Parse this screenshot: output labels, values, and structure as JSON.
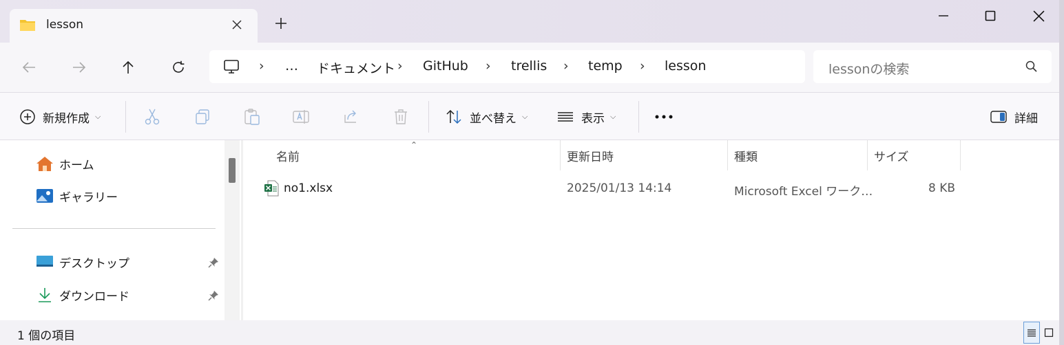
{
  "window": {
    "tab_title": "lesson",
    "minimize_icon": "minimize-icon",
    "maximize_icon": "maximize-icon",
    "close_icon": "close-icon"
  },
  "breadcrumb": {
    "overflow": "…",
    "segments": [
      "ドキュメント",
      "GitHub",
      "trellis",
      "temp",
      "lesson"
    ]
  },
  "search": {
    "placeholder": "lessonの検索"
  },
  "toolbar": {
    "new_label": "新規作成",
    "sort_label": "並べ替え",
    "view_label": "表示",
    "more_label": "•••",
    "details_label": "詳細"
  },
  "nav_pane": {
    "items": [
      {
        "label": "ホーム",
        "icon": "home-icon",
        "pinned": false
      },
      {
        "label": "ギャラリー",
        "icon": "gallery-icon",
        "pinned": false
      },
      {
        "label": "デスクトップ",
        "icon": "desktop-icon",
        "pinned": true
      },
      {
        "label": "ダウンロード",
        "icon": "download-icon",
        "pinned": true
      }
    ]
  },
  "columns": {
    "name": "名前",
    "modified": "更新日時",
    "type": "種類",
    "size": "サイズ"
  },
  "files": [
    {
      "name": "no1.xlsx",
      "modified": "2025/01/13 14:14",
      "type": "Microsoft Excel ワーク…",
      "size": "8 KB",
      "icon": "excel-file-icon"
    }
  ],
  "status": {
    "item_count": "1 個の項目"
  },
  "colors": {
    "accent": "#0067c0",
    "titlebar": "#e6e1ed",
    "excel_green": "#1e7145"
  }
}
